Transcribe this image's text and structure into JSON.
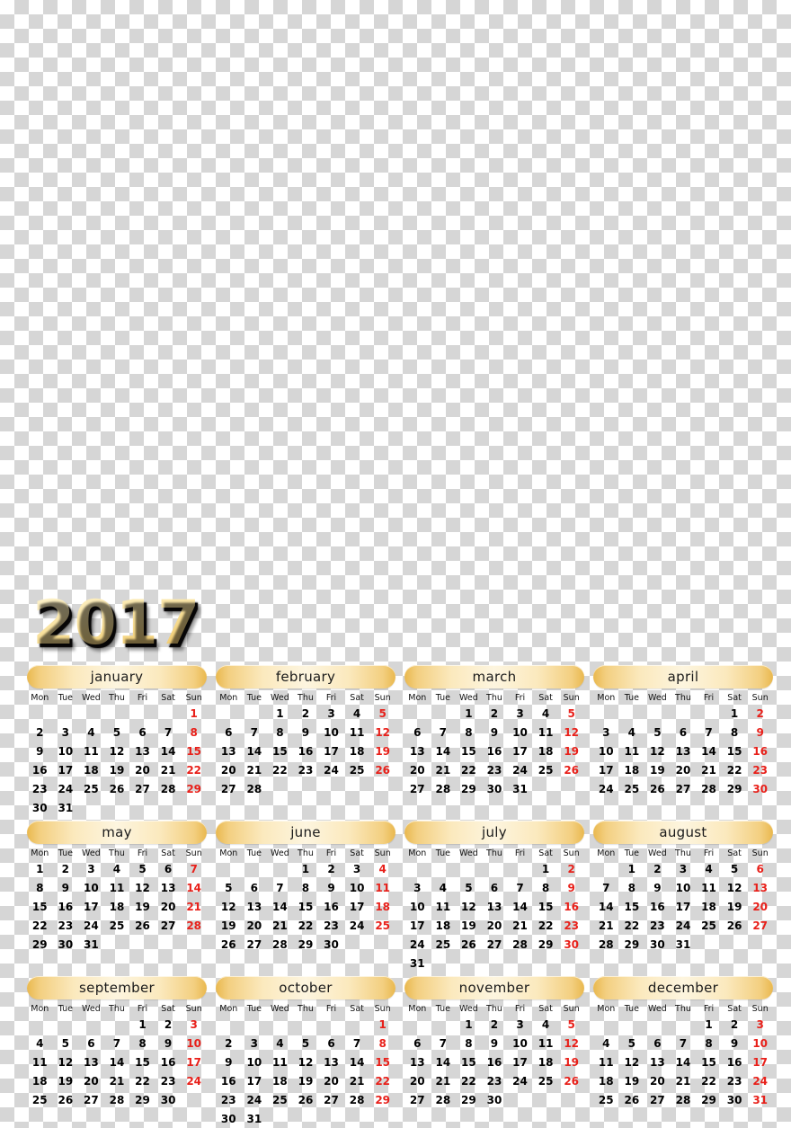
{
  "year": "2017",
  "weekday_headers": [
    "Mon",
    "Tue",
    "Wed",
    "Thu",
    "Fri",
    "Sat",
    "Sun"
  ],
  "colors": {
    "sunday": "#e8201a",
    "weekday": "#000000",
    "header_gradient_edge": "#e9b84e",
    "header_gradient_center": "#fdf5df",
    "year_gradient_light": "#fdf3cf",
    "year_gradient_dark": "#efc463"
  },
  "months": [
    {
      "name": "january",
      "weeks": [
        [
          "",
          "",
          "",
          "",
          "",
          "",
          "1"
        ],
        [
          "2",
          "3",
          "4",
          "5",
          "6",
          "7",
          "8"
        ],
        [
          "9",
          "10",
          "11",
          "12",
          "13",
          "14",
          "15"
        ],
        [
          "16",
          "17",
          "18",
          "19",
          "20",
          "21",
          "22"
        ],
        [
          "23",
          "24",
          "25",
          "26",
          "27",
          "28",
          "29"
        ],
        [
          "30",
          "31",
          "",
          "",
          "",
          "",
          ""
        ]
      ]
    },
    {
      "name": "february",
      "weeks": [
        [
          "",
          "",
          "1",
          "2",
          "3",
          "4",
          "5"
        ],
        [
          "6",
          "7",
          "8",
          "9",
          "10",
          "11",
          "12"
        ],
        [
          "13",
          "14",
          "15",
          "16",
          "17",
          "18",
          "19"
        ],
        [
          "20",
          "21",
          "22",
          "23",
          "24",
          "25",
          "26"
        ],
        [
          "27",
          "28",
          "",
          "",
          "",
          "",
          ""
        ]
      ]
    },
    {
      "name": "march",
      "weeks": [
        [
          "",
          "",
          "1",
          "2",
          "3",
          "4",
          "5"
        ],
        [
          "6",
          "7",
          "8",
          "9",
          "10",
          "11",
          "12"
        ],
        [
          "13",
          "14",
          "15",
          "16",
          "17",
          "18",
          "19"
        ],
        [
          "20",
          "21",
          "22",
          "23",
          "24",
          "25",
          "26"
        ],
        [
          "27",
          "28",
          "29",
          "30",
          "31",
          "",
          ""
        ]
      ]
    },
    {
      "name": "april",
      "weeks": [
        [
          "",
          "",
          "",
          "",
          "",
          "1",
          "2"
        ],
        [
          "3",
          "4",
          "5",
          "6",
          "7",
          "8",
          "9"
        ],
        [
          "10",
          "11",
          "12",
          "13",
          "14",
          "15",
          "16"
        ],
        [
          "17",
          "18",
          "19",
          "20",
          "21",
          "22",
          "23"
        ],
        [
          "24",
          "25",
          "26",
          "27",
          "28",
          "29",
          "30"
        ]
      ]
    },
    {
      "name": "may",
      "weeks": [
        [
          "1",
          "2",
          "3",
          "4",
          "5",
          "6",
          "7"
        ],
        [
          "8",
          "9",
          "10",
          "11",
          "12",
          "13",
          "14"
        ],
        [
          "15",
          "16",
          "17",
          "18",
          "19",
          "20",
          "21"
        ],
        [
          "22",
          "23",
          "24",
          "25",
          "26",
          "27",
          "28"
        ],
        [
          "29",
          "30",
          "31",
          "",
          "",
          "",
          ""
        ]
      ]
    },
    {
      "name": "june",
      "weeks": [
        [
          "",
          "",
          "",
          "1",
          "2",
          "3",
          "4"
        ],
        [
          "5",
          "6",
          "7",
          "8",
          "9",
          "10",
          "11"
        ],
        [
          "12",
          "13",
          "14",
          "15",
          "16",
          "17",
          "18"
        ],
        [
          "19",
          "20",
          "21",
          "22",
          "23",
          "24",
          "25"
        ],
        [
          "26",
          "27",
          "28",
          "29",
          "30",
          "",
          ""
        ]
      ]
    },
    {
      "name": "july",
      "weeks": [
        [
          "",
          "",
          "",
          "",
          "",
          "1",
          "2"
        ],
        [
          "3",
          "4",
          "5",
          "6",
          "7",
          "8",
          "9"
        ],
        [
          "10",
          "11",
          "12",
          "13",
          "14",
          "15",
          "16"
        ],
        [
          "17",
          "18",
          "19",
          "20",
          "21",
          "22",
          "23"
        ],
        [
          "24",
          "25",
          "26",
          "27",
          "28",
          "29",
          "30"
        ],
        [
          "31",
          "",
          "",
          "",
          "",
          "",
          ""
        ]
      ]
    },
    {
      "name": "august",
      "weeks": [
        [
          "",
          "1",
          "2",
          "3",
          "4",
          "5",
          "6"
        ],
        [
          "7",
          "8",
          "9",
          "10",
          "11",
          "12",
          "13"
        ],
        [
          "14",
          "15",
          "16",
          "17",
          "18",
          "19",
          "20"
        ],
        [
          "21",
          "22",
          "23",
          "24",
          "25",
          "26",
          "27"
        ],
        [
          "28",
          "29",
          "30",
          "31",
          "",
          "",
          ""
        ]
      ]
    },
    {
      "name": "september",
      "weeks": [
        [
          "",
          "",
          "",
          "",
          "1",
          "2",
          "3"
        ],
        [
          "4",
          "5",
          "6",
          "7",
          "8",
          "9",
          "10"
        ],
        [
          "11",
          "12",
          "13",
          "14",
          "15",
          "16",
          "17"
        ],
        [
          "18",
          "19",
          "20",
          "21",
          "22",
          "23",
          "24"
        ],
        [
          "25",
          "26",
          "27",
          "28",
          "29",
          "30",
          ""
        ]
      ]
    },
    {
      "name": "october",
      "weeks": [
        [
          "",
          "",
          "",
          "",
          "",
          "",
          "1"
        ],
        [
          "2",
          "3",
          "4",
          "5",
          "6",
          "7",
          "8"
        ],
        [
          "9",
          "10",
          "11",
          "12",
          "13",
          "14",
          "15"
        ],
        [
          "16",
          "17",
          "18",
          "19",
          "20",
          "21",
          "22"
        ],
        [
          "23",
          "24",
          "25",
          "26",
          "27",
          "28",
          "29"
        ],
        [
          "30",
          "31",
          "",
          "",
          "",
          "",
          ""
        ]
      ]
    },
    {
      "name": "november",
      "weeks": [
        [
          "",
          "",
          "1",
          "2",
          "3",
          "4",
          "5"
        ],
        [
          "6",
          "7",
          "8",
          "9",
          "10",
          "11",
          "12"
        ],
        [
          "13",
          "14",
          "15",
          "16",
          "17",
          "18",
          "19"
        ],
        [
          "20",
          "21",
          "22",
          "23",
          "24",
          "25",
          "26"
        ],
        [
          "27",
          "28",
          "29",
          "30",
          "",
          "",
          ""
        ]
      ]
    },
    {
      "name": "december",
      "weeks": [
        [
          "",
          "",
          "",
          "",
          "1",
          "2",
          "3"
        ],
        [
          "4",
          "5",
          "6",
          "7",
          "8",
          "9",
          "10"
        ],
        [
          "11",
          "12",
          "13",
          "14",
          "15",
          "16",
          "17"
        ],
        [
          "18",
          "19",
          "20",
          "21",
          "22",
          "23",
          "24"
        ],
        [
          "25",
          "26",
          "27",
          "28",
          "29",
          "30",
          "31"
        ]
      ]
    }
  ]
}
